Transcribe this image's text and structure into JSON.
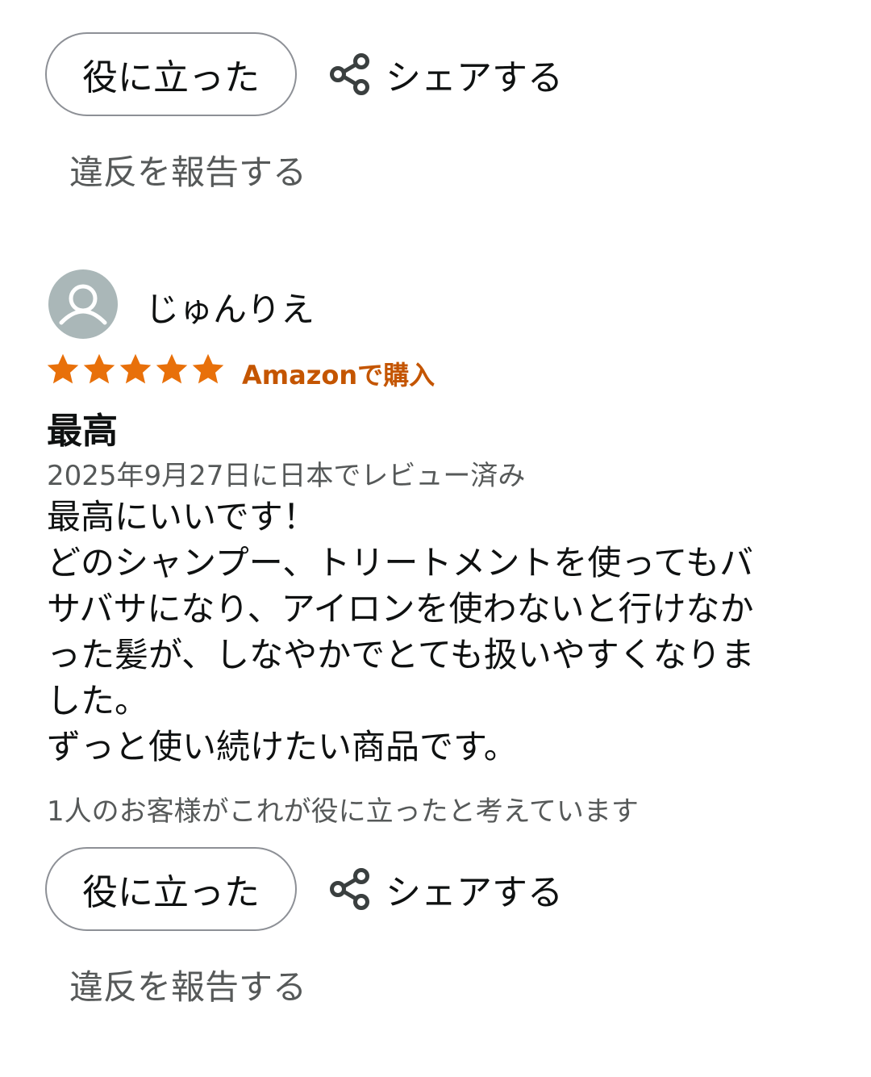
{
  "top_actions": {
    "helpful_label": "役に立った",
    "share_label": "シェアする",
    "report_label": "違反を報告する"
  },
  "review": {
    "reviewer_name": "じゅんりえ",
    "rating": 5,
    "rating_max": 5,
    "verified_label": "Amazonで購入",
    "title": "最高",
    "date_line": "2025年9月27日に日本でレビュー済み",
    "body_lines": [
      "最高にいいです！",
      "どのシャンプー、トリートメントを使ってもバ",
      "サバサになり、アイロンを使わないと行けなか",
      "った髪が、しなやかでとても扱いやすくなりま",
      "した。",
      "ずっと使い続けたい商品です。"
    ],
    "helpful_count_text": "1人のお客様がこれが役に立ったと考えています"
  },
  "bottom_actions": {
    "helpful_label": "役に立った",
    "share_label": "シェアする",
    "report_label": "違反を報告する"
  },
  "icons": {
    "share": "share-icon",
    "avatar": "user-avatar-icon",
    "star": "star-icon"
  },
  "colors": {
    "star": "#e8700a",
    "verified": "#c45500",
    "muted_text": "#565959",
    "button_border": "#8d9096",
    "avatar_bg": "#aab7b8"
  }
}
